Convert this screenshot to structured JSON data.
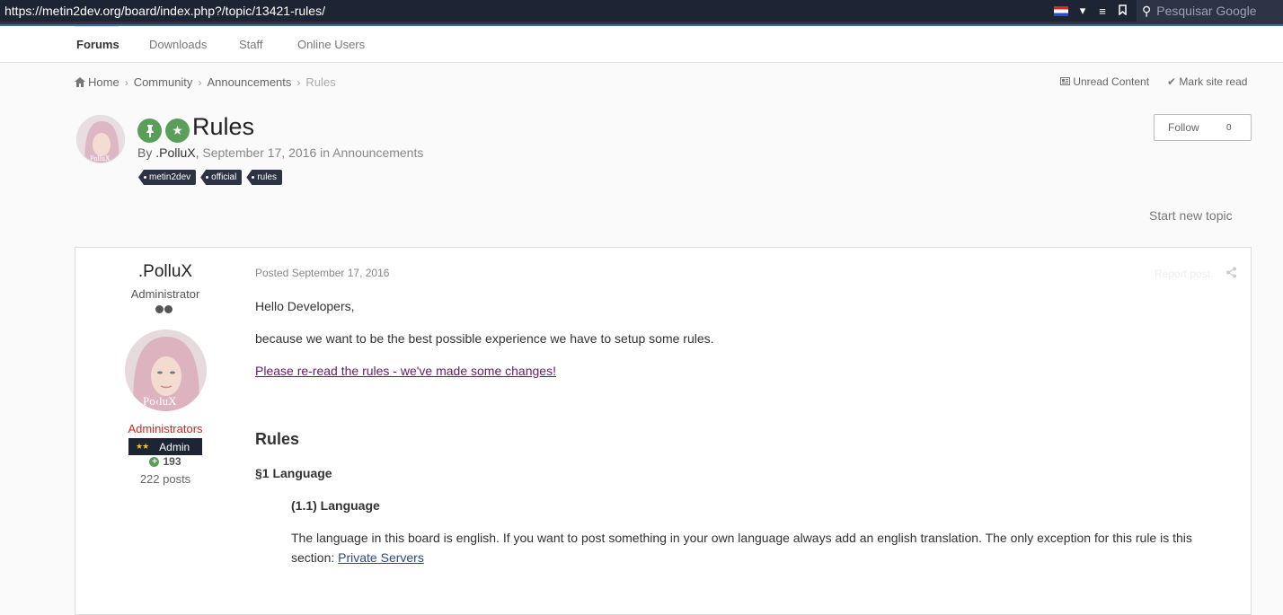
{
  "browser": {
    "url": "https://metin2dev.org/board/index.php?/topic/13421-rules/",
    "search_placeholder": "Pesquisar Google"
  },
  "nav": {
    "items": [
      "Forums",
      "Downloads",
      "Staff",
      "Online Users"
    ]
  },
  "breadcrumb": {
    "home": "Home",
    "community": "Community",
    "announcements": "Announcements",
    "current": "Rules"
  },
  "top_links": {
    "unread": "Unread Content",
    "mark_read": "Mark site read"
  },
  "topic": {
    "title": "Rules",
    "by": "By",
    "author": ".PolluX",
    "date": "September 17, 2016",
    "in": "in",
    "forum": "Announcements",
    "tags": [
      "metin2dev",
      "official",
      "rules"
    ],
    "follow_label": "Follow",
    "follow_count": "0",
    "start_new_topic": "Start new topic"
  },
  "post": {
    "author_name": ".PolluX",
    "author_title": "Administrator",
    "group": "Administrators",
    "badge": "Admin",
    "reputation": "193",
    "posts": "222 posts",
    "posted": "Posted September 17, 2016",
    "report": "Report post",
    "greeting": "Hello Developers,",
    "intro": "because we want to be the best possible experience we have to setup some rules.",
    "reread_link": "Please re-read the rules - we've made some changes!",
    "rules_heading": "Rules",
    "section1": "§1 Language",
    "sub1": "(1.1) Language",
    "sub1_text": "The language in this board is english. If you want to post something in your own language always add an english translation. The only exception for this rule is this section: ",
    "sub1_link": "Private Servers"
  }
}
